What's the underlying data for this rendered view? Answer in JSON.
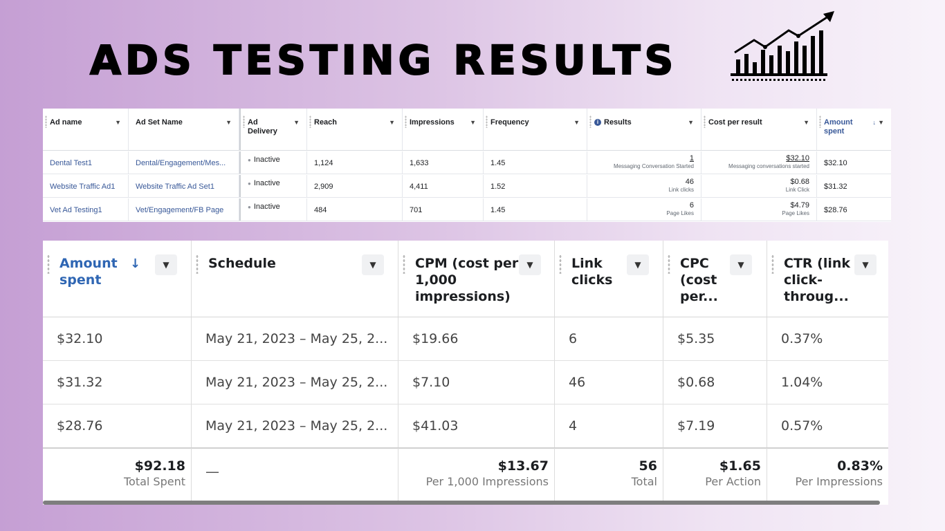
{
  "title": "ADS TESTING RESULTS",
  "icons": {
    "header": "growth-chart-icon"
  },
  "ads_table": {
    "headers": [
      "Ad name",
      "Ad Set Name",
      "Ad Delivery",
      "Reach",
      "Impressions",
      "Frequency",
      "Results",
      "Cost per result",
      "Amount spent"
    ],
    "rows": [
      {
        "ad_name": "Dental Test1",
        "ad_set": "Dental/Engagement/Mes...",
        "delivery": "Inactive",
        "reach": "1,124",
        "impressions": "1,633",
        "frequency": "1.45",
        "results": "1",
        "results_sub": "Messaging Conversation Started",
        "cost": "$32.10",
        "cost_sub": "Messaging conversations started",
        "spent": "$32.10"
      },
      {
        "ad_name": "Website Traffic Ad1",
        "ad_set": "Website Traffic Ad Set1",
        "delivery": "Inactive",
        "reach": "2,909",
        "impressions": "4,411",
        "frequency": "1.52",
        "results": "46",
        "results_sub": "Link clicks",
        "cost": "$0.68",
        "cost_sub": "Link Click",
        "spent": "$31.32"
      },
      {
        "ad_name": "Vet Ad Testing1",
        "ad_set": "Vet/Engagement/FB Page",
        "delivery": "Inactive",
        "reach": "484",
        "impressions": "701",
        "frequency": "1.45",
        "results": "6",
        "results_sub": "Page Likes",
        "cost": "$4.79",
        "cost_sub": "Page Likes",
        "spent": "$28.76"
      }
    ]
  },
  "metrics_table": {
    "headers": [
      "Amount spent",
      "Schedule",
      "CPM (cost per 1,000 impressions)",
      "Link clicks",
      "CPC (cost per...",
      "CTR (link click-throug..."
    ],
    "rows": [
      {
        "spent": "$32.10",
        "schedule": "May 21, 2023 – May 25, 2...",
        "cpm": "$19.66",
        "clicks": "6",
        "cpc": "$5.35",
        "ctr": "0.37%"
      },
      {
        "spent": "$31.32",
        "schedule": "May 21, 2023 – May 25, 2...",
        "cpm": "$7.10",
        "clicks": "46",
        "cpc": "$0.68",
        "ctr": "1.04%"
      },
      {
        "spent": "$28.76",
        "schedule": "May 21, 2023 – May 25, 2...",
        "cpm": "$41.03",
        "clicks": "4",
        "cpc": "$7.19",
        "ctr": "0.57%"
      }
    ],
    "totals": {
      "spent": "$92.18",
      "spent_label": "Total Spent",
      "schedule": "—",
      "cpm": "$13.67",
      "cpm_label": "Per 1,000 Impressions",
      "clicks": "56",
      "clicks_label": "Total",
      "cpc": "$1.65",
      "cpc_label": "Per Action",
      "ctr": "0.83%",
      "ctr_label": "Per Impressions"
    }
  },
  "colors": {
    "accent_blue": "#2f66b3",
    "link_blue": "#385898",
    "bg_left": "#c59fd4",
    "bg_right": "#f8f3fa"
  }
}
